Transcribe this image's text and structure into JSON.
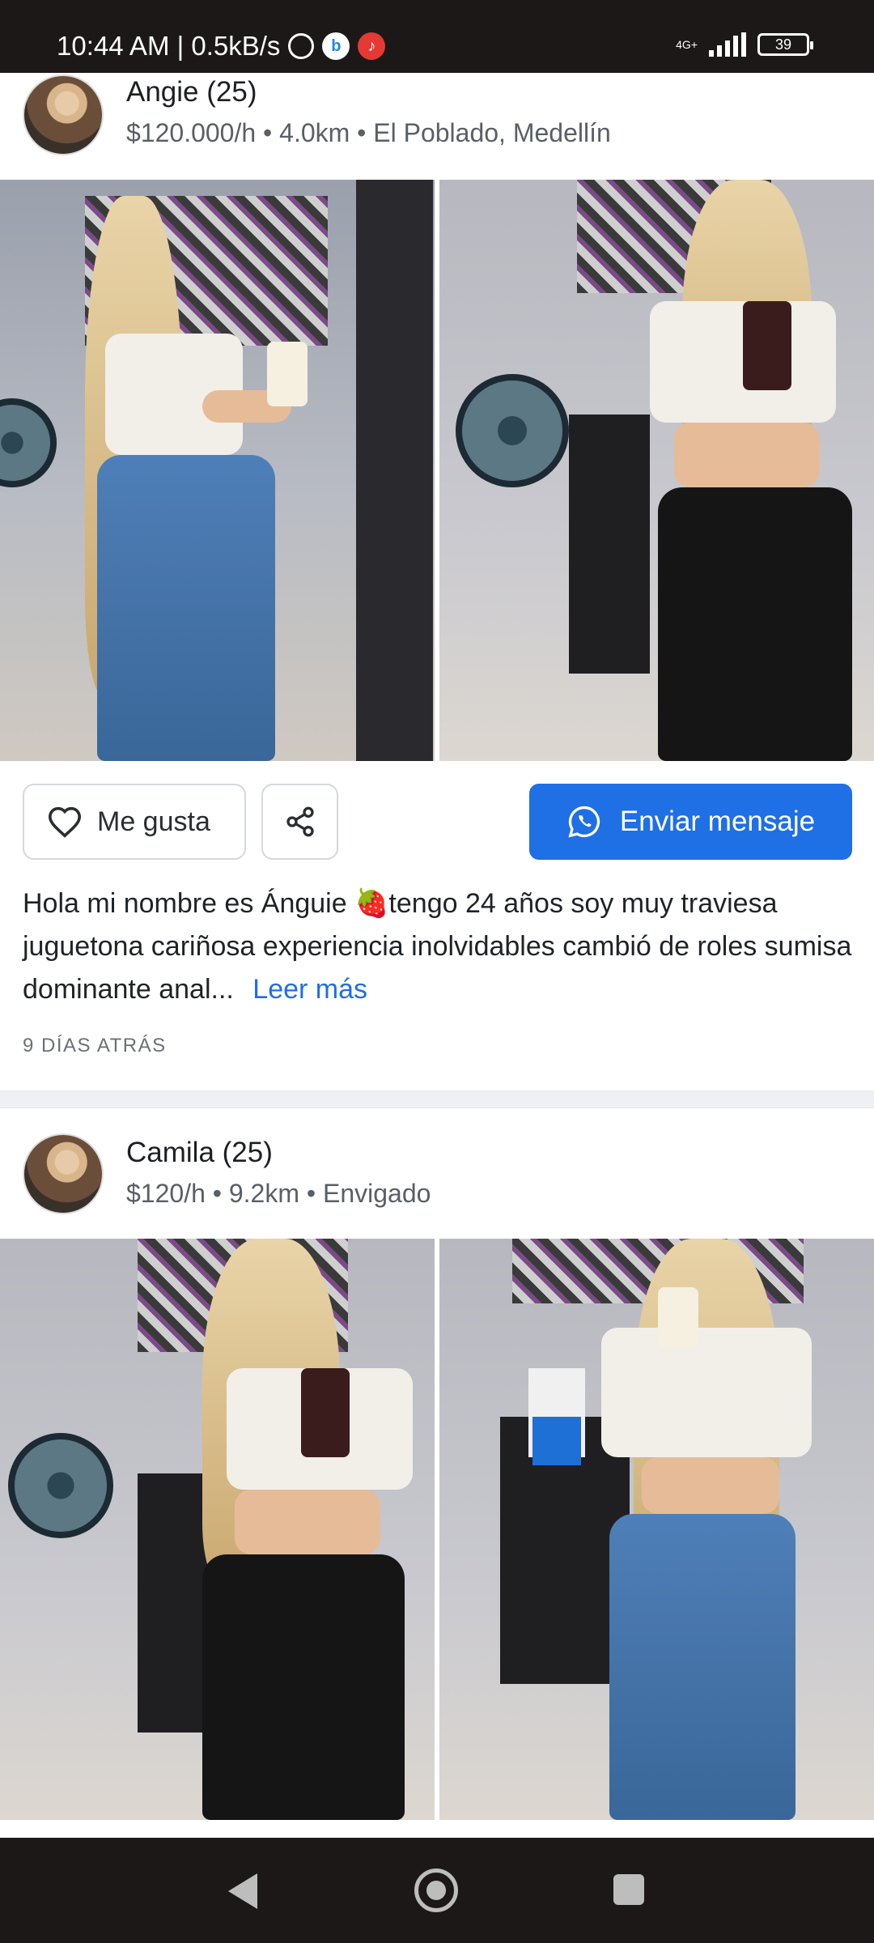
{
  "status_bar": {
    "time_speed": "10:44 AM | 0.5kB/s",
    "network": "4G+",
    "battery": "39",
    "icons": [
      "alarm-icon",
      "bing-icon",
      "tiktok-icon",
      "signal-icon",
      "battery-icon"
    ]
  },
  "posts": [
    {
      "name": "Angie (25)",
      "meta": "$120.000/h • 4.0km • El Poblado, Medellín",
      "like_label": "Me gusta",
      "message_label": "Enviar mensaje",
      "description": "Hola mi nombre es Ánguie 🍓tengo 24 años soy muy traviesa juguetona cariñosa experiencia inolvidables cambió de roles sumisa dominante anal...",
      "read_more": "Leer más",
      "time_ago": "9 DÍAS ATRÁS"
    },
    {
      "name": "Camila (25)",
      "meta": "$120/h • 9.2km • Envigado"
    }
  ],
  "colors": {
    "accent": "#1f6fe5",
    "status_bar_bg": "#1c1818",
    "divider": "#eef0f3"
  }
}
